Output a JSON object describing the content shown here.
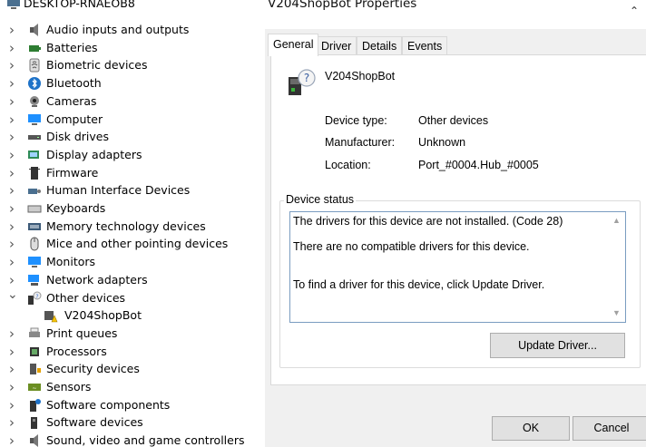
{
  "tree": {
    "root_label": "DESKTOP-RNAEOB8",
    "items": [
      {
        "label": "Audio inputs and outputs",
        "expanded": false
      },
      {
        "label": "Batteries",
        "expanded": false
      },
      {
        "label": "Biometric devices",
        "expanded": false
      },
      {
        "label": "Bluetooth",
        "expanded": false
      },
      {
        "label": "Cameras",
        "expanded": false
      },
      {
        "label": "Computer",
        "expanded": false
      },
      {
        "label": "Disk drives",
        "expanded": false
      },
      {
        "label": "Display adapters",
        "expanded": false
      },
      {
        "label": "Firmware",
        "expanded": false
      },
      {
        "label": "Human Interface Devices",
        "expanded": false
      },
      {
        "label": "Keyboards",
        "expanded": false
      },
      {
        "label": "Memory technology devices",
        "expanded": false
      },
      {
        "label": "Mice and other pointing devices",
        "expanded": false
      },
      {
        "label": "Monitors",
        "expanded": false
      },
      {
        "label": "Network adapters",
        "expanded": false
      },
      {
        "label": "Other devices",
        "expanded": true
      },
      {
        "label": "V204ShopBot",
        "child": true
      },
      {
        "label": "Print queues",
        "expanded": false
      },
      {
        "label": "Processors",
        "expanded": false
      },
      {
        "label": "Security devices",
        "expanded": false
      },
      {
        "label": "Sensors",
        "expanded": false
      },
      {
        "label": "Software components",
        "expanded": false
      },
      {
        "label": "Software devices",
        "expanded": false
      },
      {
        "label": "Sound, video and game controllers",
        "expanded": false
      }
    ]
  },
  "dialog": {
    "title": "V204ShopBot Properties",
    "tabs": [
      "General",
      "Driver",
      "Details",
      "Events"
    ],
    "active_tab": "General",
    "device_name": "V204ShopBot",
    "props": {
      "type_label": "Device type:",
      "type_value": "Other devices",
      "manufacturer_label": "Manufacturer:",
      "manufacturer_value": "Unknown",
      "location_label": "Location:",
      "location_value": "Port_#0004.Hub_#0005"
    },
    "status_title": "Device status",
    "status_lines": [
      "The drivers for this device are not installed. (Code 28)",
      "There are no compatible drivers for this device.",
      "To find a driver for this device, click Update Driver."
    ],
    "update_driver_label": "Update Driver...",
    "ok_label": "OK",
    "cancel_label": "Cancel"
  }
}
